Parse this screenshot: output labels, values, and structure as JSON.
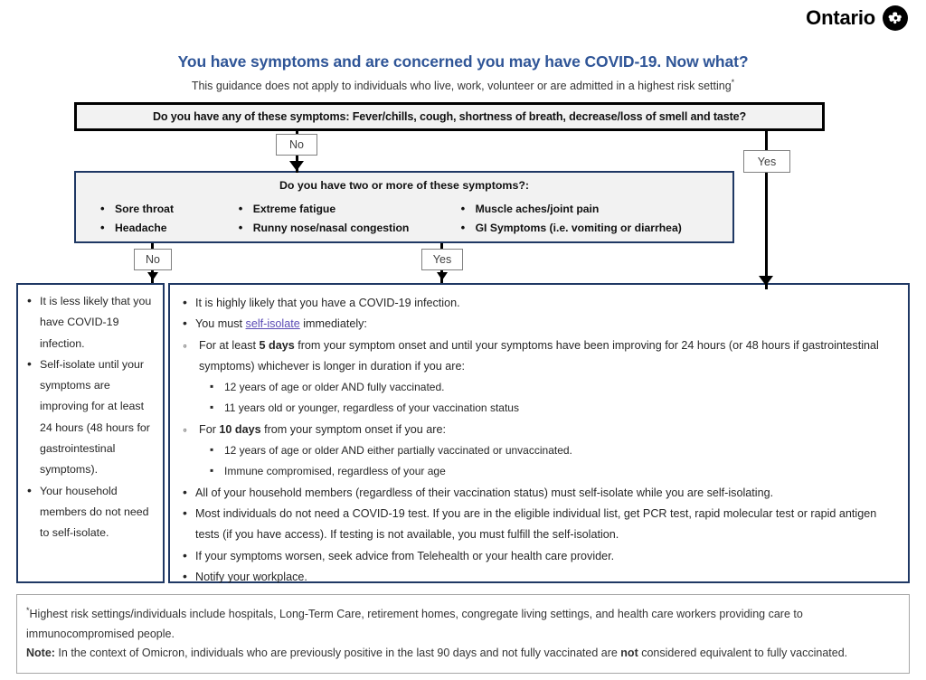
{
  "brand": {
    "wordmark": "Ontario",
    "logo_icon": "ontario-trillium-icon",
    "logo_color": "#000000"
  },
  "header": {
    "title": "You have symptoms and are concerned you may have COVID-19. Now what?",
    "title_color": "#2F5597",
    "subtitle": "This guidance does not apply to individuals who live, work, volunteer or are admitted in a highest risk setting",
    "subtitle_marker": "*"
  },
  "flow": {
    "question_1": {
      "text": "Do you have any of these symptoms: Fever/chills, cough, shortness of breath, decrease/loss of smell and taste?",
      "border_color": "#000000",
      "fill_color": "#F2F2F2"
    },
    "question_2": {
      "heading": "Do you have two or more of these symptoms?:",
      "border_color": "#1F3864",
      "fill_color": "#F2F2F2",
      "columns": [
        [
          "Sore throat",
          "Headache"
        ],
        [
          "Extreme fatigue",
          "Runny nose/nasal congestion"
        ],
        [
          "Muscle aches/joint pain",
          "GI Symptoms (i.e. vomiting or diarrhea)"
        ]
      ]
    },
    "edge_labels": {
      "q1_no": "No",
      "q1_yes": "Yes",
      "q2_no": "No",
      "q2_yes": "Yes"
    }
  },
  "outcomes": {
    "low_risk": {
      "border_color": "#1F3864",
      "bullets": [
        "It is less likely that you have COVID-19 infection.",
        "Self-isolate until your symptoms are improving for at least 24 hours (48 hours for gastrointestinal symptoms).",
        "Your household members do not need to self-isolate."
      ]
    },
    "high_risk": {
      "border_color": "#1F3864",
      "items": [
        {
          "level": 1,
          "pre": "It is highly likely that you have a COVID-19 infection.",
          "link": "",
          "post": ""
        },
        {
          "level": 1,
          "pre": "You must ",
          "link": "self-isolate",
          "post": " immediately:"
        },
        {
          "level": 2,
          "pre": "For at least ",
          "bold": "5 days",
          "post": " from your symptom onset and until your symptoms have been improving for 24 hours (or 48 hours if gastrointestinal symptoms) whichever is longer in duration if you are:"
        },
        {
          "level": 3,
          "pre": "12 years of age or older AND fully vaccinated."
        },
        {
          "level": 3,
          "pre": "11 years old or younger, regardless of your vaccination status"
        },
        {
          "level": 2,
          "pre": "For ",
          "bold": "10 days",
          "post": " from your symptom onset if you are:"
        },
        {
          "level": 3,
          "pre": "12 years of age or older AND either partially vaccinated or unvaccinated."
        },
        {
          "level": 3,
          "pre": "Immune compromised, regardless of your age"
        },
        {
          "level": 1,
          "pre": "All of your household members (regardless of their vaccination status) must self-isolate while you are self-isolating."
        },
        {
          "level": 1,
          "pre": "Most individuals do not need a COVID-19 test. If you are in the eligible individual list, get PCR test, rapid molecular test or rapid antigen tests (if you have access). If testing is not available, you must fulfill the self-isolation."
        },
        {
          "level": 1,
          "pre": "If your symptoms worsen, seek advice from Telehealth or your health care provider."
        },
        {
          "level": 1,
          "pre": "Notify your workplace."
        }
      ]
    }
  },
  "footnote": {
    "marker": "*",
    "line1": "Highest risk settings/individuals include hospitals, Long-Term Care, retirement homes, congregate living settings, and health care workers providing care to immunocompromised people.",
    "note_label": "Note:",
    "note_part1": " In the context of Omicron, individuals who are previously positive in the last 90 days and not fully vaccinated are ",
    "note_bold": "not",
    "note_part2": " considered equivalent to fully vaccinated."
  }
}
